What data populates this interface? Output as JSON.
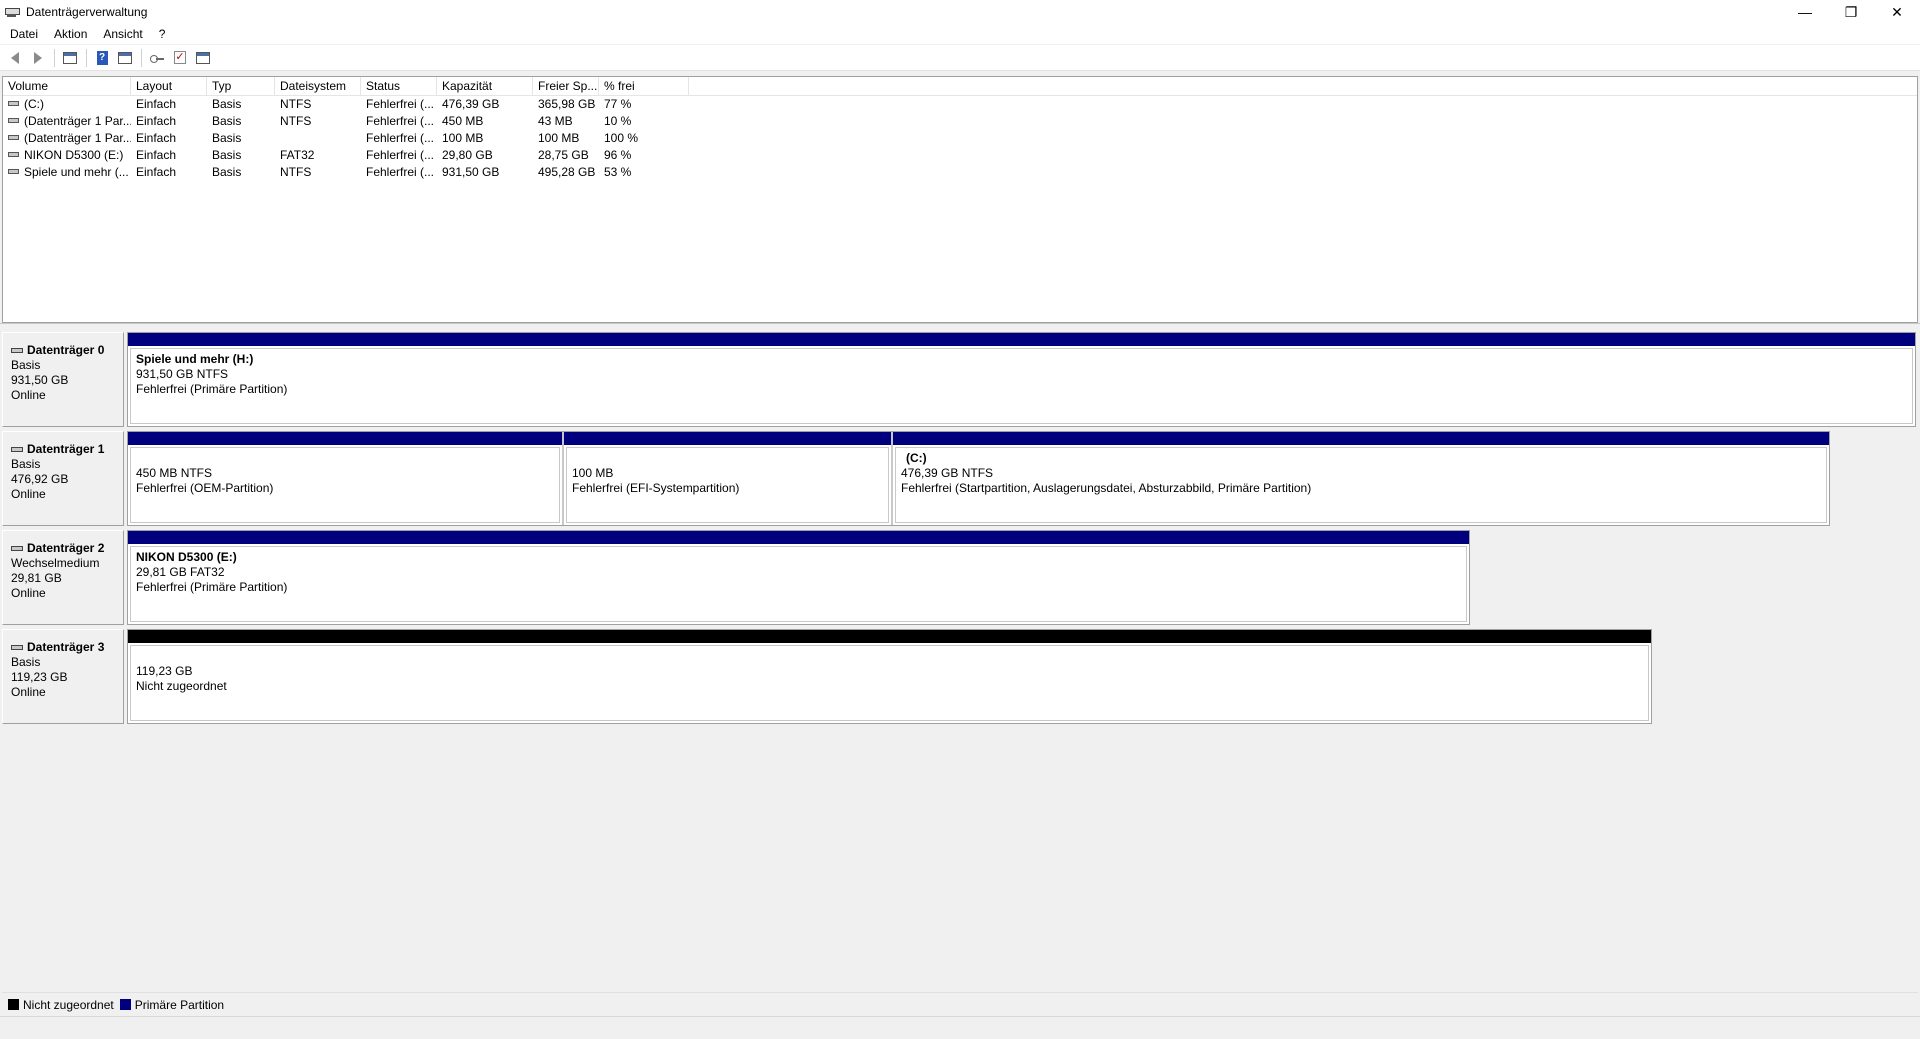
{
  "window": {
    "title": "Datenträgerverwaltung",
    "controls": {
      "minimize": "—",
      "restore": "❐",
      "close": "✕"
    }
  },
  "menu": [
    "Datei",
    "Aktion",
    "Ansicht",
    "?"
  ],
  "toolbar": [
    "back-icon",
    "forward-icon",
    "console-tree-icon",
    "help-icon",
    "properties-icon",
    "rescan-icon",
    "check-icon",
    "settings-icon"
  ],
  "colors": {
    "primary_partition": "#00007f",
    "unallocated": "#000000"
  },
  "volume_list": {
    "columns": [
      "Volume",
      "Layout",
      "Typ",
      "Dateisystem",
      "Status",
      "Kapazität",
      "Freier Sp...",
      "% frei"
    ],
    "rows": [
      [
        "(C:)",
        "Einfach",
        "Basis",
        "NTFS",
        "Fehlerfrei (...",
        "476,39 GB",
        "365,98 GB",
        "77 %"
      ],
      [
        "(Datenträger 1 Par...",
        "Einfach",
        "Basis",
        "NTFS",
        "Fehlerfrei (...",
        "450 MB",
        "43 MB",
        "10 %"
      ],
      [
        "(Datenträger 1 Par...",
        "Einfach",
        "Basis",
        "",
        "Fehlerfrei (...",
        "100 MB",
        "100 MB",
        "100 %"
      ],
      [
        "NIKON D5300 (E:)",
        "Einfach",
        "Basis",
        "FAT32",
        "Fehlerfrei (...",
        "29,80 GB",
        "28,75 GB",
        "96 %"
      ],
      [
        "Spiele und mehr (...",
        "Einfach",
        "Basis",
        "NTFS",
        "Fehlerfrei (...",
        "931,50 GB",
        "495,28 GB",
        "53 %"
      ]
    ]
  },
  "disks": [
    {
      "name": "Datenträger 0",
      "type": "Basis",
      "size": "931,50 GB",
      "status": "Online",
      "partitions": [
        {
          "name": "Spiele und mehr  (H:)",
          "line1": "931,50 GB NTFS",
          "line2": "Fehlerfrei (Primäre Partition)",
          "kind": "primary"
        }
      ]
    },
    {
      "name": "Datenträger 1",
      "type": "Basis",
      "size": "476,92 GB",
      "status": "Online",
      "partitions": [
        {
          "name": "",
          "line1": "450 MB NTFS",
          "line2": "Fehlerfrei (OEM-Partition)",
          "kind": "primary"
        },
        {
          "name": "",
          "line1": "100 MB",
          "line2": "Fehlerfrei (EFI-Systempartition)",
          "kind": "primary"
        },
        {
          "name": "(C:)",
          "line1": "476,39 GB NTFS",
          "line2": "Fehlerfrei (Startpartition, Auslagerungsdatei, Absturzabbild, Primäre Partition)",
          "kind": "primary"
        }
      ]
    },
    {
      "name": "Datenträger 2",
      "type": "Wechselmedium",
      "size": "29,81 GB",
      "status": "Online",
      "partitions": [
        {
          "name": "NIKON D5300  (E:)",
          "line1": "29,81 GB FAT32",
          "line2": "Fehlerfrei (Primäre Partition)",
          "kind": "primary"
        }
      ]
    },
    {
      "name": "Datenträger 3",
      "type": "Basis",
      "size": "119,23 GB",
      "status": "Online",
      "partitions": [
        {
          "name": "",
          "line1": "119,23 GB",
          "line2": "Nicht zugeordnet",
          "kind": "unallocated"
        }
      ]
    }
  ],
  "legend": [
    {
      "label": "Nicht zugeordnet",
      "kind": "unallocated"
    },
    {
      "label": "Primäre Partition",
      "kind": "primary"
    }
  ]
}
